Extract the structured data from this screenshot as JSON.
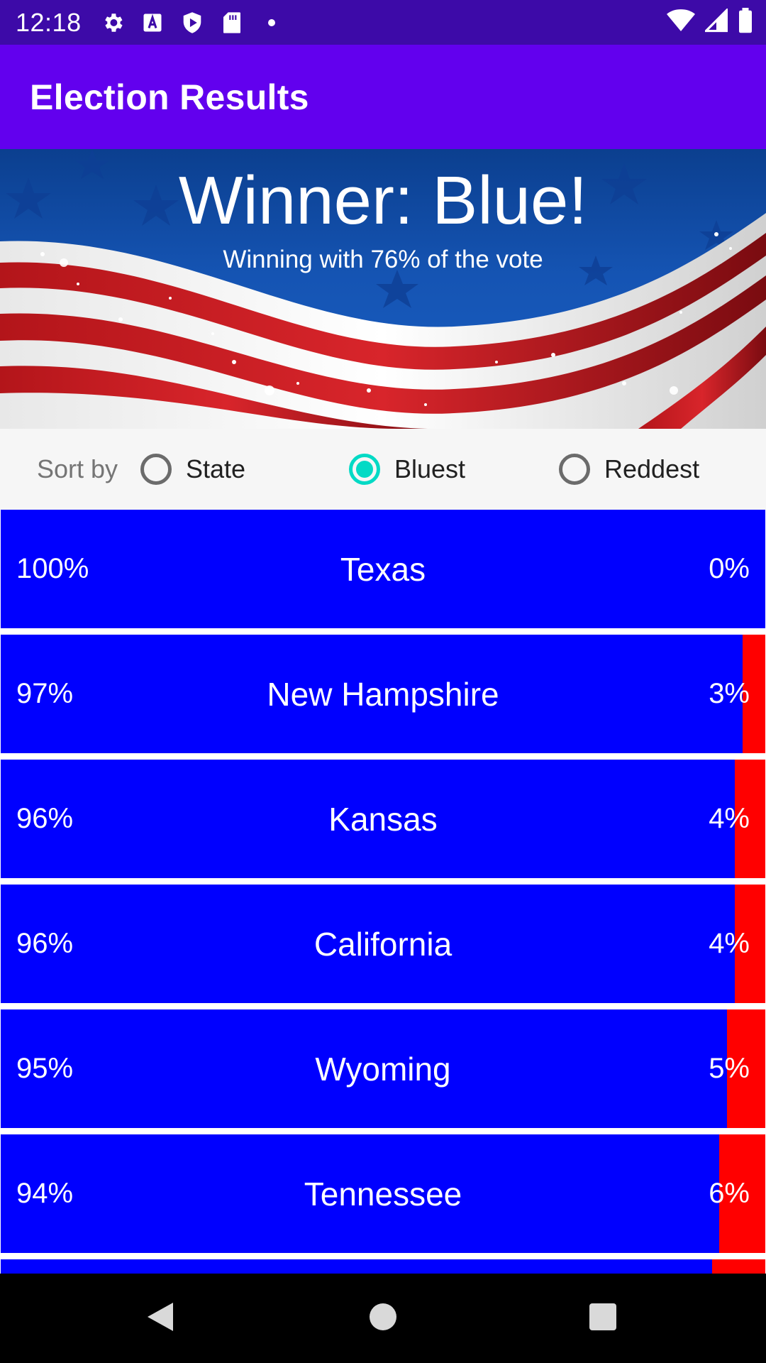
{
  "status_bar": {
    "time": "12:18",
    "icons_left": [
      "settings-icon",
      "font-a-icon",
      "play-shield-icon",
      "sd-card-icon",
      "dot-icon"
    ],
    "icons_right": [
      "wifi-icon",
      "signal-icon",
      "battery-icon"
    ]
  },
  "app_bar": {
    "title": "Election Results",
    "color": "#6200ee"
  },
  "banner": {
    "title": "Winner: Blue!",
    "subtitle": "Winning with 76% of the vote"
  },
  "sort": {
    "label": "Sort by",
    "options": [
      {
        "label": "State",
        "selected": false
      },
      {
        "label": "Bluest",
        "selected": true
      },
      {
        "label": "Reddest",
        "selected": false
      }
    ],
    "accent": "#03dac5"
  },
  "colors": {
    "blue": "#0000ff",
    "red": "#ff0000"
  },
  "results": [
    {
      "state": "Texas",
      "blue_pct": "100%",
      "red_pct": "0%",
      "red_share": 0.0
    },
    {
      "state": "New Hampshire",
      "blue_pct": "97%",
      "red_pct": "3%",
      "red_share": 0.03
    },
    {
      "state": "Kansas",
      "blue_pct": "96%",
      "red_pct": "4%",
      "red_share": 0.04
    },
    {
      "state": "California",
      "blue_pct": "96%",
      "red_pct": "4%",
      "red_share": 0.04
    },
    {
      "state": "Wyoming",
      "blue_pct": "95%",
      "red_pct": "5%",
      "red_share": 0.05
    },
    {
      "state": "Tennessee",
      "blue_pct": "94%",
      "red_pct": "6%",
      "red_share": 0.06
    },
    {
      "state": "",
      "blue_pct": "",
      "red_pct": "",
      "red_share": 0.07
    }
  ],
  "nav": [
    "back-icon",
    "home-icon",
    "recents-icon"
  ]
}
